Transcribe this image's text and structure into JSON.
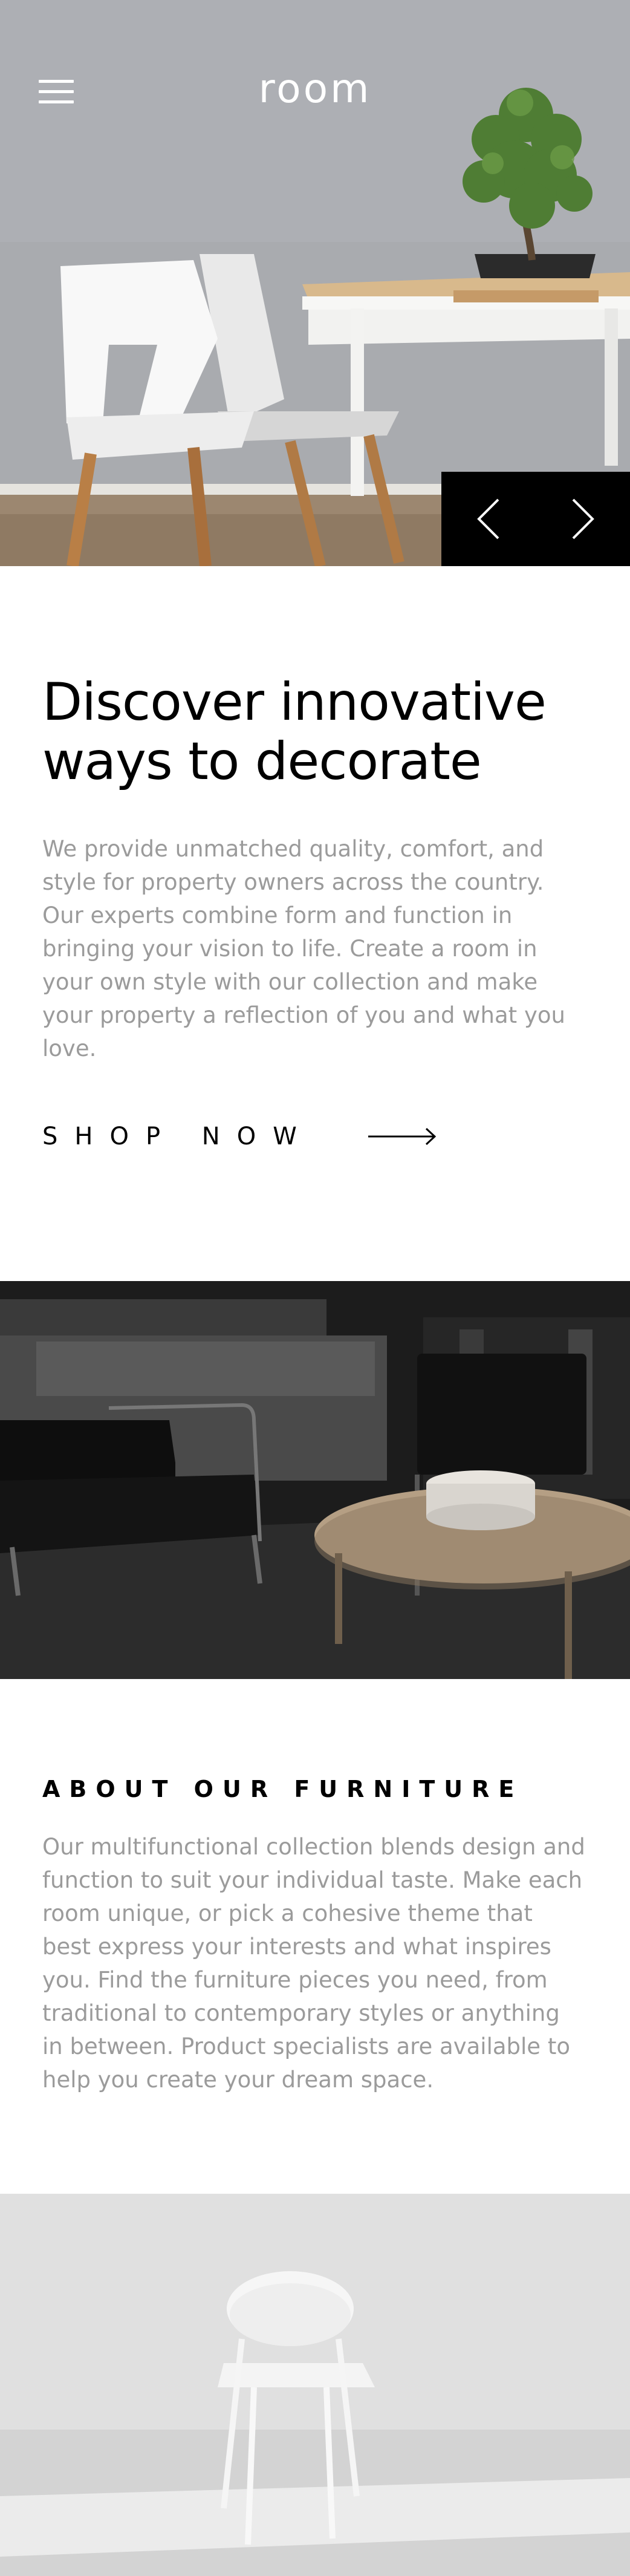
{
  "header": {
    "logo": "room",
    "menu_icon": "hamburger-menu-icon"
  },
  "hero": {
    "prev_icon": "chevron-left-icon",
    "next_icon": "chevron-right-icon"
  },
  "intro": {
    "headline": "Discover innovative ways to decorate",
    "body": "We provide unmatched quality, comfort, and style for property owners across the country. Our experts combine form and function in bringing your vision to life. Create a room in your own style with our collection and make your property a reflection of you and what you love.",
    "cta_label": "SHOP NOW",
    "cta_icon": "arrow-right-icon"
  },
  "about": {
    "title": "ABOUT OUR FURNITURE",
    "body": "Our multifunctional collection blends design and function to suit your individual taste. Make each room unique, or pick a cohesive theme that best express your interests and what inspires you. Find the furniture pieces you need, from traditional to contemporary styles or anything in between. Product specialists are available to help you create your dream space."
  },
  "colors": {
    "text_dark": "#000000",
    "text_muted": "#9b9b9b",
    "nav_bg": "#000000"
  }
}
